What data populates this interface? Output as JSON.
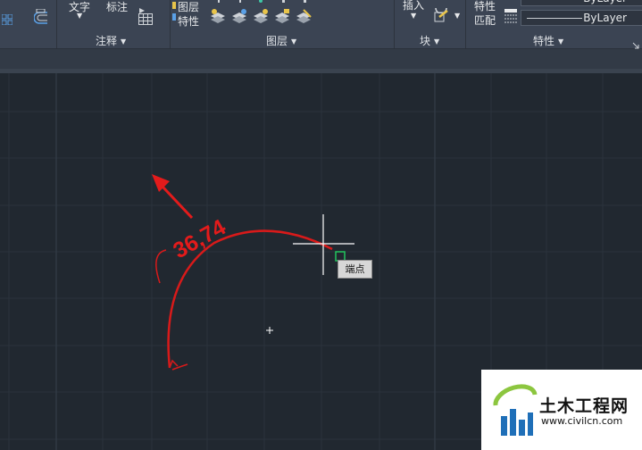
{
  "ribbon": {
    "annotation_panel": {
      "text_label": "文字",
      "dimension_label": "标注",
      "title": "注释"
    },
    "layers_panel": {
      "layer_properties_line1": "图层",
      "layer_properties_line2": "特性",
      "title": "图层"
    },
    "block_panel": {
      "insert_label": "插入",
      "title": "块"
    },
    "properties_panel": {
      "match_line1": "特性",
      "match_line2": "匹配",
      "linetype_value": "ByLayer",
      "title": "特性"
    }
  },
  "canvas": {
    "dimension_text": "36,74",
    "snap_tooltip": "端点",
    "colors": {
      "background": "#212830",
      "annotation_red": "#e31b1b",
      "snap_marker": "#22c55e",
      "crosshair": "#ffffff"
    }
  },
  "watermark": {
    "title": "土木工程网",
    "url": "www.civilcn.com"
  }
}
